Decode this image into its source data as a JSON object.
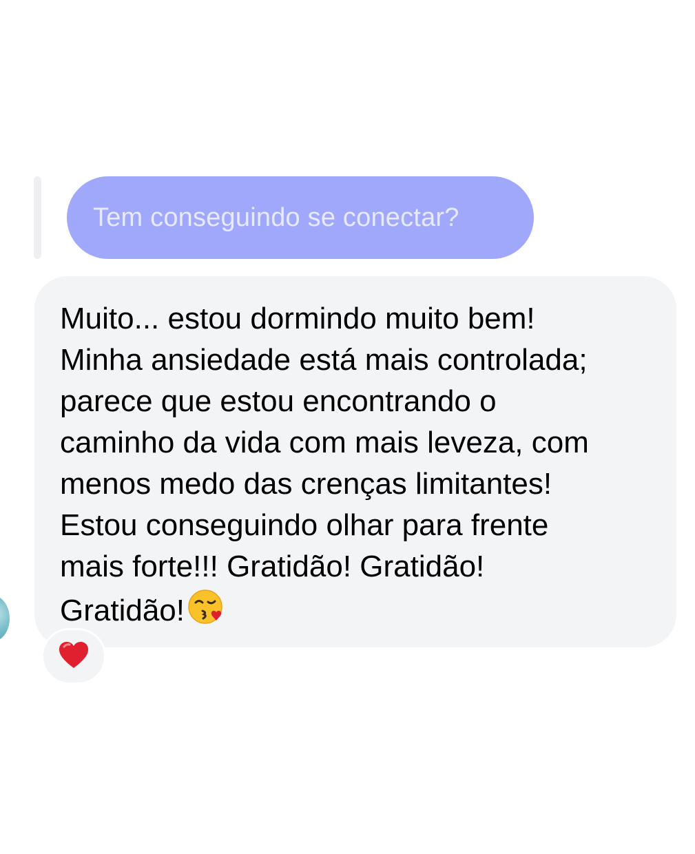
{
  "quoted_message": {
    "text": "Tem conseguindo se conectar?"
  },
  "message": {
    "lines": [
      "Muito... estou dormindo muito bem!",
      "Minha ansiedade está mais controlada;",
      "parece que estou encontrando o",
      "caminho da vida com mais leveza, com",
      "menos medo das crenças limitantes!",
      "Estou conseguindo olhar para frente",
      "mais forte!!! Gratidão! Gratidão!",
      "Gratidão!"
    ],
    "trailing_emoji": "face-blowing-a-kiss-icon"
  },
  "reaction": {
    "icon": "red-heart-icon"
  },
  "colors": {
    "quoted_bubble": "#a0a8fb",
    "quoted_text": "#e7e9ff",
    "message_bubble": "#f3f4f6",
    "heart": "#e0202e",
    "emoji_face": "#f9c22b"
  }
}
